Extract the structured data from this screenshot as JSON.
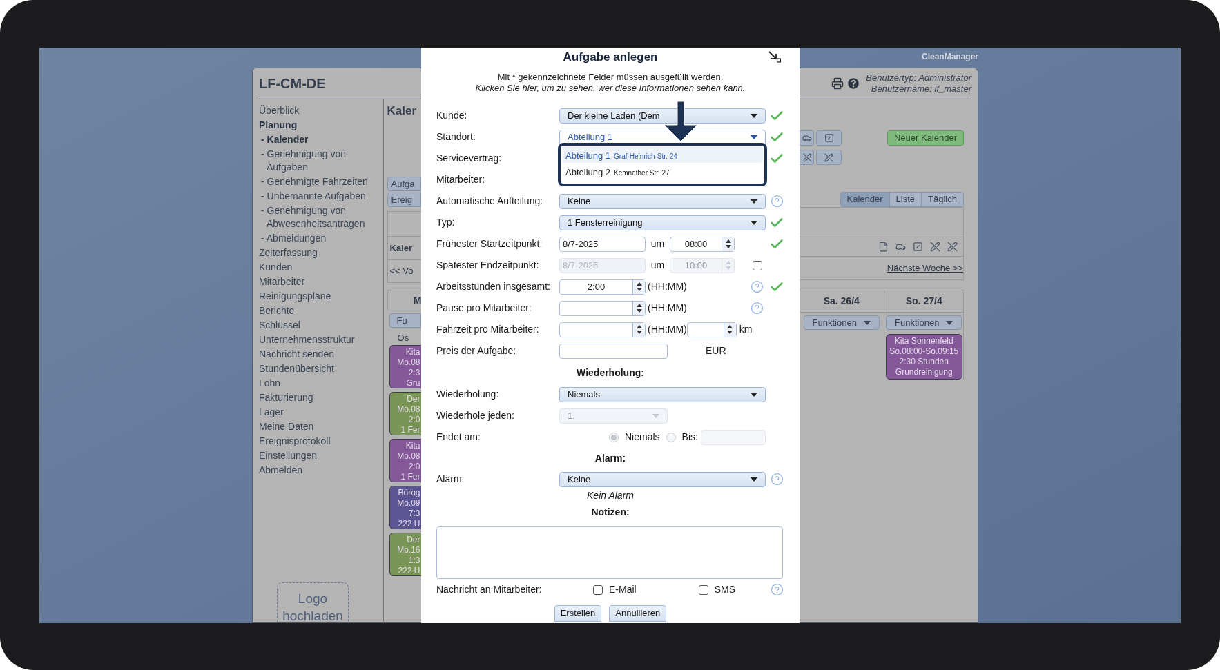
{
  "brand": "CleanManager",
  "app": {
    "title": "LF-CM-DE",
    "user_info": [
      "Benutzertyp: Administrator",
      "Benutzername: lf_master"
    ]
  },
  "sidebar": {
    "items": [
      {
        "label": "Überblick",
        "selected": false
      },
      {
        "label": "Planung",
        "selected": true,
        "children": [
          {
            "label": "- Kalender",
            "selected": true
          },
          {
            "label": "- Genehmigung von Aufgaben",
            "selected": false
          },
          {
            "label": "- Genehmigte Fahrzeiten",
            "selected": false
          },
          {
            "label": "- Unbemannte Aufgaben",
            "selected": false
          },
          {
            "label": "- Genehmigung von Abwesenheitsanträgen",
            "selected": false
          },
          {
            "label": "- Abmeldungen",
            "selected": false
          }
        ]
      },
      {
        "label": "Zeiterfassung",
        "selected": false
      },
      {
        "label": "Kunden",
        "selected": false
      },
      {
        "label": "Mitarbeiter",
        "selected": false
      },
      {
        "label": "Reinigungspläne",
        "selected": false
      },
      {
        "label": "Berichte",
        "selected": false
      },
      {
        "label": "Schlüssel",
        "selected": false
      },
      {
        "label": "Unternehmensstruktur",
        "selected": false
      },
      {
        "label": "Nachricht senden",
        "selected": false
      },
      {
        "label": "Stundenübersicht",
        "selected": false
      },
      {
        "label": "Lohn",
        "selected": false
      },
      {
        "label": "Fakturierung",
        "selected": false
      },
      {
        "label": "Lager",
        "selected": false
      },
      {
        "label": "Meine Daten",
        "selected": false
      },
      {
        "label": "Ereignisprotokoll",
        "selected": false
      },
      {
        "label": "Einstellungen",
        "selected": false
      },
      {
        "label": "Abmelden",
        "selected": false
      }
    ],
    "logo_upload": "Logo hochladen"
  },
  "left_strip": {
    "heading": "Kaler",
    "buttons": [
      "Aufga",
      "Ereig"
    ],
    "subheading": "Kaler",
    "prev_link": "<< Vo",
    "column_header": "M",
    "functions_button": "Fu",
    "group_label": "Os",
    "events": [
      {
        "lines": [
          "Kita",
          "Mo.08",
          "2:3",
          "Gru"
        ],
        "color": "#85589a"
      },
      {
        "lines": [
          "Der",
          "Mo.08",
          "2:0",
          "1 Fer"
        ],
        "color": "#7a9656"
      },
      {
        "lines": [
          "Kita",
          "Mo.08",
          "2:0",
          "1 Fer"
        ],
        "color": "#85589a"
      },
      {
        "lines": [
          "Bürog",
          "Mo.09",
          "7:3",
          "222 U"
        ],
        "color": "#5c5594"
      },
      {
        "lines": [
          "Der",
          "Mo.16",
          "1:3",
          "222 U"
        ],
        "color": "#7a9656"
      }
    ]
  },
  "right_strip": {
    "new_calendar": "Neuer Kalender",
    "view_tabs": [
      {
        "label": "Kalender",
        "selected": true
      },
      {
        "label": "Liste",
        "selected": false
      },
      {
        "label": "Täglich",
        "selected": false
      }
    ],
    "next_link": "Nächste Woche >>",
    "days": [
      {
        "label": "Sa. 26/4",
        "button": "Funktionen"
      },
      {
        "label": "So. 27/4",
        "button": "Funktionen",
        "events": [
          {
            "lines": [
              "Kita Sonnenfeld",
              "So.08:00-So.09:15",
              "2:30 Stunden",
              "Grundreinigung"
            ],
            "color": "#85589a"
          }
        ]
      }
    ]
  },
  "dialog": {
    "title": "Aufgabe anlegen",
    "required_note": "Mit * gekennzeichnete Felder müssen ausgefüllt werden.",
    "visibility_link": "Klicken Sie hier, um zu sehen, wer diese Informationen sehen kann.",
    "rows": [
      {
        "kind": "select",
        "label": "Kunde:",
        "value": "Der kleine Laden (Dem",
        "open": false,
        "disabled": false,
        "check": true
      },
      {
        "kind": "select",
        "label": "Standort:",
        "value": "Abteilung 1",
        "open": true,
        "disabled": false,
        "check": true,
        "options": [
          {
            "name": "Abteilung 1",
            "address": "Graf-Heinrich-Str. 24",
            "selected": true
          },
          {
            "name": "Abteilung 2",
            "address": "Kemnather Str. 27",
            "selected": false
          }
        ]
      },
      {
        "kind": "hidden",
        "label": "Servicevertrag:",
        "check": true
      },
      {
        "kind": "hidden",
        "label": "Mitarbeiter:"
      },
      {
        "kind": "select",
        "label": "Automatische Aufteilung:",
        "value": "Keine",
        "open": false,
        "disabled": false,
        "help": true
      },
      {
        "kind": "select",
        "label": "Typ:",
        "value": "1 Fensterreinigung",
        "open": false,
        "disabled": false,
        "check": true
      },
      {
        "kind": "datetime",
        "label": "Frühester Startzeitpunkt:",
        "date": "8/7-2025",
        "at": "um",
        "time": "08:00",
        "disabled": false,
        "check": true
      },
      {
        "kind": "datetime",
        "label": "Spätester Endzeitpunkt:",
        "date": "8/7-2025",
        "at": "um",
        "time": "10:00",
        "disabled": true,
        "checkbox": {
          "checked": false
        }
      },
      {
        "kind": "duration",
        "label": "Arbeitsstunden insgesamt:",
        "value": "2:00",
        "unit": "(HH:MM)",
        "help": true,
        "check": true
      },
      {
        "kind": "duration",
        "label": "Pause pro Mitarbeiter:",
        "unit": "(HH:MM)",
        "help": true
      },
      {
        "kind": "travel",
        "label": "Fahrzeit pro Mitarbeiter:",
        "unit": "(HH:MM)",
        "distance_unit": "km"
      },
      {
        "kind": "price",
        "label": "Preis der Aufgabe:",
        "currency": "EUR"
      },
      {
        "kind": "heading",
        "label": "Wiederholung:"
      },
      {
        "kind": "select",
        "label": "Wiederholung:",
        "value": "Niemals",
        "open": false,
        "disabled": false
      },
      {
        "kind": "select_small",
        "label": "Wiederhole jeden:",
        "value": "1.",
        "disabled": true
      },
      {
        "kind": "radio",
        "label": "Endet am:",
        "options": [
          {
            "label": "Niemals",
            "selected": true
          },
          {
            "label": "Bis:",
            "selected": false
          }
        ]
      },
      {
        "kind": "heading",
        "label": "Alarm:"
      },
      {
        "kind": "select",
        "label": "Alarm:",
        "value": "Keine",
        "open": false,
        "disabled": false,
        "help": true
      },
      {
        "kind": "note",
        "label": "Kein Alarm"
      },
      {
        "kind": "heading",
        "label": "Notizen:"
      },
      {
        "kind": "textarea"
      },
      {
        "kind": "notify",
        "label": "Nachricht an Mitarbeiter:",
        "options": [
          {
            "label": "E-Mail",
            "checked": false
          },
          {
            "label": "SMS",
            "checked": false
          }
        ],
        "help": true
      }
    ],
    "buttons": [
      "Erstellen",
      "Annullieren"
    ]
  }
}
